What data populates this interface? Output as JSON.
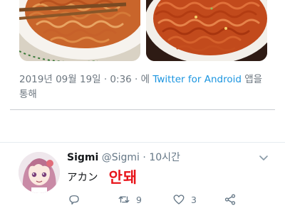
{
  "meta": {
    "timestamp": "2019년 09월 19일 · 0:36 · 에",
    "app_name": "Twitter for Android",
    "suffix_line1": "앱을",
    "suffix_line2": "통해"
  },
  "tweet": {
    "author_name": "Sigmi",
    "handle": "@Sigmi",
    "separator": "·",
    "time_ago": "10시간",
    "text_japanese": "アカン",
    "text_korean_red": "안돼",
    "retweet_count": "9",
    "like_count": "3"
  },
  "icons": {
    "reply": "reply-icon",
    "retweet": "retweet-icon",
    "like": "heart-icon",
    "share": "share-icon",
    "caret": "chevron-down-icon"
  },
  "colors": {
    "link": "#1b95e0",
    "muted": "#657786",
    "highlight_text": "#e8141a"
  }
}
